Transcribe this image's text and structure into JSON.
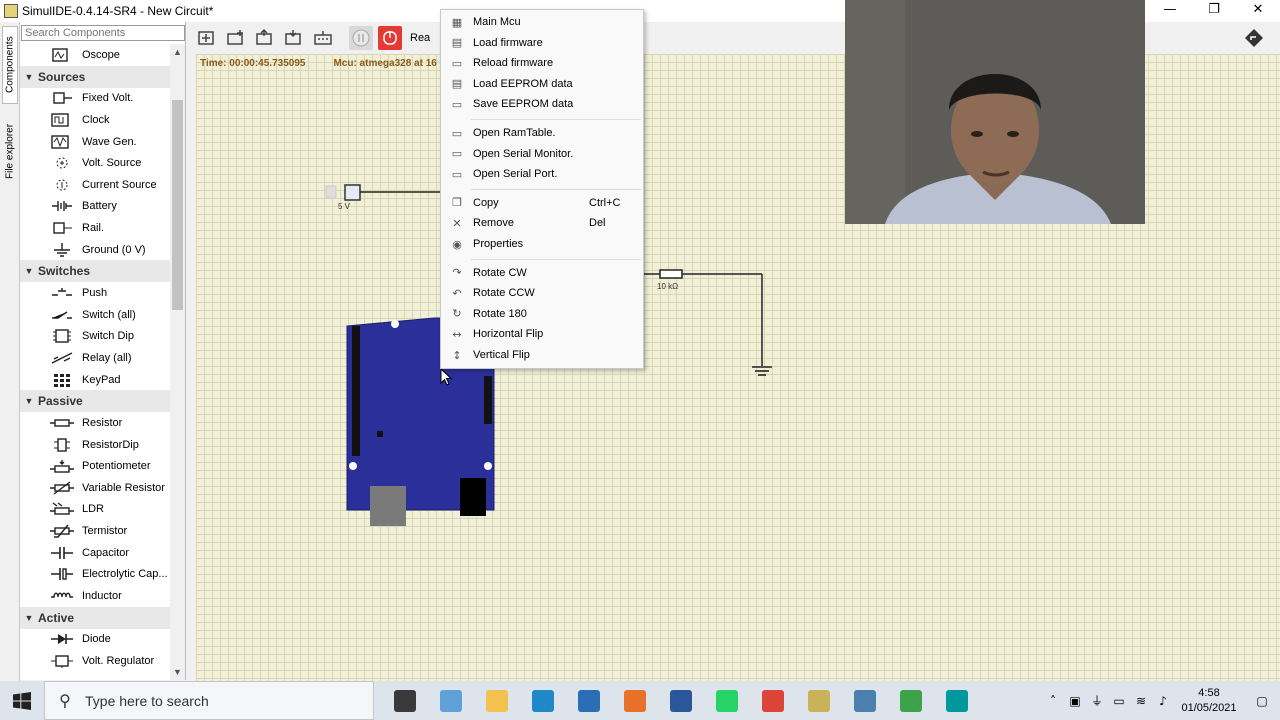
{
  "window": {
    "title": "SimulIDE-0.4.14-SR4   -   New Circuit*",
    "controls": [
      "—",
      "❐",
      "✕"
    ]
  },
  "side_tabs": [
    "Components",
    "File explorer"
  ],
  "components_panel": {
    "search_placeholder": "Search Components",
    "items": [
      {
        "type": "item",
        "label": "Oscope",
        "icon": "oscope-icon"
      },
      {
        "type": "category",
        "label": "Sources"
      },
      {
        "type": "item",
        "label": "Fixed Volt.",
        "icon": "fixed-volt-icon"
      },
      {
        "type": "item",
        "label": "Clock",
        "icon": "clock-icon"
      },
      {
        "type": "item",
        "label": "Wave Gen.",
        "icon": "wave-gen-icon"
      },
      {
        "type": "item",
        "label": "Volt. Source",
        "icon": "volt-source-icon"
      },
      {
        "type": "item",
        "label": "Current Source",
        "icon": "current-source-icon"
      },
      {
        "type": "item",
        "label": "Battery",
        "icon": "battery-icon"
      },
      {
        "type": "item",
        "label": "Rail.",
        "icon": "rail-icon"
      },
      {
        "type": "item",
        "label": "Ground (0 V)",
        "icon": "ground-icon"
      },
      {
        "type": "category",
        "label": "Switches"
      },
      {
        "type": "item",
        "label": "Push",
        "icon": "push-icon"
      },
      {
        "type": "item",
        "label": "Switch (all)",
        "icon": "switch-icon"
      },
      {
        "type": "item",
        "label": "Switch Dip",
        "icon": "switch-dip-icon"
      },
      {
        "type": "item",
        "label": "Relay (all)",
        "icon": "relay-icon"
      },
      {
        "type": "item",
        "label": "KeyPad",
        "icon": "keypad-icon"
      },
      {
        "type": "category",
        "label": "Passive"
      },
      {
        "type": "item",
        "label": "Resistor",
        "icon": "resistor-icon"
      },
      {
        "type": "item",
        "label": "ResistorDip",
        "icon": "resistor-dip-icon"
      },
      {
        "type": "item",
        "label": "Potentiometer",
        "icon": "potentiometer-icon"
      },
      {
        "type": "item",
        "label": "Variable Resistor",
        "icon": "variable-resistor-icon"
      },
      {
        "type": "item",
        "label": "LDR",
        "icon": "ldr-icon"
      },
      {
        "type": "item",
        "label": "Termistor",
        "icon": "termistor-icon"
      },
      {
        "type": "item",
        "label": "Capacitor",
        "icon": "capacitor-icon"
      },
      {
        "type": "item",
        "label": "Electrolytic Cap...",
        "icon": "electrolytic-cap-icon"
      },
      {
        "type": "item",
        "label": "Inductor",
        "icon": "inductor-icon"
      },
      {
        "type": "category",
        "label": "Active"
      },
      {
        "type": "item",
        "label": "Diode",
        "icon": "diode-icon"
      },
      {
        "type": "item",
        "label": "Volt. Regulator",
        "icon": "volt-regulator-icon"
      }
    ]
  },
  "toolbar": {
    "label": "Rea",
    "buttons": [
      "new-circuit-icon",
      "open-icon",
      "save-icon",
      "save-as-icon",
      "settings-icon",
      "pause-icon",
      "power-icon"
    ]
  },
  "canvas": {
    "status_time": "Time: 00:00:45.735095",
    "status_mcu": "Mcu: atmega328 at 16",
    "fixed_volt_label": "5 V",
    "resistor_label": "10 kΩ"
  },
  "context_menu": {
    "groups": [
      [
        {
          "label": "Main Mcu",
          "icon": "chip-icon",
          "shortcut": ""
        },
        {
          "label": "Load firmware",
          "icon": "load-icon",
          "shortcut": ""
        },
        {
          "label": "Reload firmware",
          "icon": "reload-icon",
          "shortcut": ""
        },
        {
          "label": "Load EEPROM data",
          "icon": "load-eeprom-icon",
          "shortcut": ""
        },
        {
          "label": "Save EEPROM data",
          "icon": "save-eeprom-icon",
          "shortcut": ""
        }
      ],
      [
        {
          "label": "Open RamTable.",
          "icon": "monitor-icon",
          "shortcut": ""
        },
        {
          "label": "Open Serial Monitor.",
          "icon": "monitor-icon",
          "shortcut": ""
        },
        {
          "label": "Open Serial Port.",
          "icon": "monitor-icon",
          "shortcut": ""
        }
      ],
      [
        {
          "label": "Copy",
          "icon": "copy-icon",
          "shortcut": "Ctrl+C"
        },
        {
          "label": "Remove",
          "icon": "remove-icon",
          "shortcut": "Del"
        },
        {
          "label": "Properties",
          "icon": "properties-icon",
          "shortcut": ""
        }
      ],
      [
        {
          "label": "Rotate CW",
          "icon": "rotate-cw-icon",
          "shortcut": ""
        },
        {
          "label": "Rotate CCW",
          "icon": "rotate-ccw-icon",
          "shortcut": ""
        },
        {
          "label": "Rotate 180",
          "icon": "rotate-180-icon",
          "shortcut": ""
        },
        {
          "label": "Horizontal Flip",
          "icon": "horizontal-flip-icon",
          "shortcut": ""
        },
        {
          "label": "Vertical Flip",
          "icon": "vertical-flip-icon",
          "shortcut": ""
        }
      ]
    ]
  },
  "taskbar": {
    "search_placeholder": "Type here to search",
    "apps": [
      {
        "name": "task-view-icon",
        "color": "#3a3a3a"
      },
      {
        "name": "app-icon",
        "color": "#5ea0d8"
      },
      {
        "name": "file-explorer-icon",
        "color": "#f2c14e"
      },
      {
        "name": "edge-icon",
        "color": "#1e88c8"
      },
      {
        "name": "mail-icon",
        "color": "#2a6fb6"
      },
      {
        "name": "firefox-icon",
        "color": "#e8702a"
      },
      {
        "name": "word-icon",
        "color": "#2b579a"
      },
      {
        "name": "whatsapp-icon",
        "color": "#25d366"
      },
      {
        "name": "chrome-icon",
        "color": "#db4437"
      },
      {
        "name": "simulide-icon",
        "color": "#c9b25a"
      },
      {
        "name": "app2-icon",
        "color": "#4a7fb0"
      },
      {
        "name": "app3-icon",
        "color": "#3ca34a"
      },
      {
        "name": "arduino-icon",
        "color": "#00979d"
      }
    ],
    "time": "4:58",
    "date": "01/05/2021"
  },
  "colors": {
    "arduino_board": "#2b2f9a",
    "canvas_bg": "#f1f0d6",
    "status_text": "#8a5a1a",
    "power_button": "#e53935"
  }
}
